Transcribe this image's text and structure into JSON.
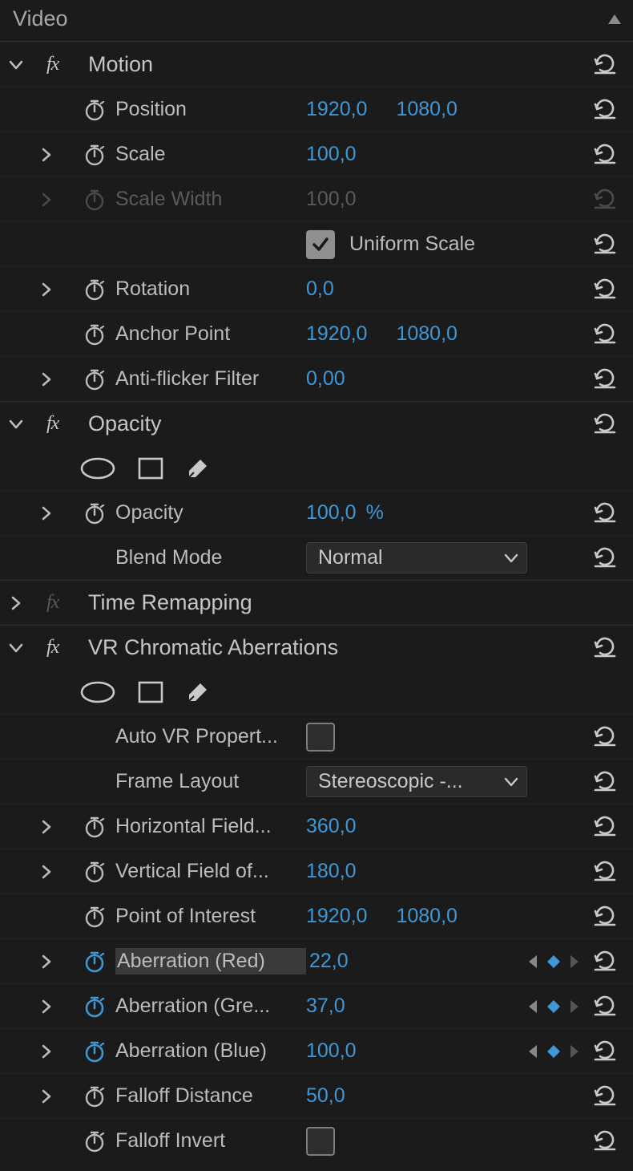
{
  "panel": {
    "title": "Video"
  },
  "effects": {
    "motion": {
      "name": "Motion",
      "position": {
        "label": "Position",
        "x": "1920,0",
        "y": "1080,0"
      },
      "scale": {
        "label": "Scale",
        "value": "100,0"
      },
      "scaleWidth": {
        "label": "Scale Width",
        "value": "100,0"
      },
      "uniformScale": {
        "label": "Uniform Scale",
        "checked": true
      },
      "rotation": {
        "label": "Rotation",
        "value": "0,0"
      },
      "anchorPoint": {
        "label": "Anchor Point",
        "x": "1920,0",
        "y": "1080,0"
      },
      "antiFlicker": {
        "label": "Anti-flicker Filter",
        "value": "0,00"
      }
    },
    "opacity": {
      "name": "Opacity",
      "opacity": {
        "label": "Opacity",
        "value": "100,0",
        "suffix": "%"
      },
      "blendMode": {
        "label": "Blend Mode",
        "value": "Normal"
      }
    },
    "timeRemap": {
      "name": "Time Remapping"
    },
    "vrca": {
      "name": "VR Chromatic Aberrations",
      "autoVR": {
        "label": "Auto VR Propert...",
        "checked": false
      },
      "frameLayout": {
        "label": "Frame Layout",
        "value": "Stereoscopic -..."
      },
      "hfov": {
        "label": "Horizontal Field...",
        "value": "360,0"
      },
      "vfov": {
        "label": "Vertical Field of...",
        "value": "180,0"
      },
      "poi": {
        "label": "Point of Interest",
        "x": "1920,0",
        "y": "1080,0"
      },
      "abRed": {
        "label": "Aberration (Red)",
        "value": "22,0"
      },
      "abGreen": {
        "label": "Aberration (Gre...",
        "value": "37,0"
      },
      "abBlue": {
        "label": "Aberration (Blue)",
        "value": "100,0"
      },
      "falloffDist": {
        "label": "Falloff Distance",
        "value": "50,0"
      },
      "falloffInvert": {
        "label": "Falloff Invert",
        "checked": false
      }
    }
  }
}
